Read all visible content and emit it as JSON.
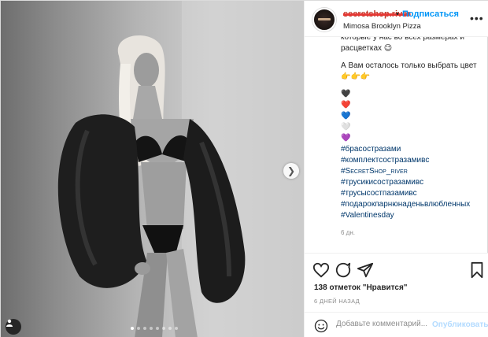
{
  "header": {
    "username": "secretshop.river",
    "separator": "•",
    "follow_label": "Подписаться",
    "location": "Mimosa Brooklyn Pizza",
    "more_icon": "more-horizontal-icon"
  },
  "caption": {
    "cut_line": "которые у нас во всех размерах и",
    "line2": "расцветках 😉",
    "line3": "А Вам осталось только выбрать цвет",
    "pointers": "👉👉👉",
    "hearts": [
      "🖤",
      "❤️",
      "💙",
      "🤍",
      "💜"
    ],
    "hashtags": [
      "#брасостразами",
      "#комплектсостразамивс",
      "#SecretShop_river",
      "#трусикисостразамивс",
      "#трусысостпазамивс",
      "#подарокпарнюнаденьвлюбленных",
      "#Valentinesday"
    ],
    "time_ago": "6 дн."
  },
  "actions": {
    "likes": "138 отметок \"Нравится\"",
    "date": "6 ДНЕЙ НАЗАД",
    "comment_placeholder": "Добавьте комментарий...",
    "publish_label": "Опубликовать"
  },
  "carousel": {
    "slide_count": 8,
    "active_index": 0
  },
  "colors": {
    "link_blue": "#0095f6",
    "hashtag": "#00376b",
    "publish_disabled": "#b3dbff",
    "muted": "#8e8e8e"
  }
}
